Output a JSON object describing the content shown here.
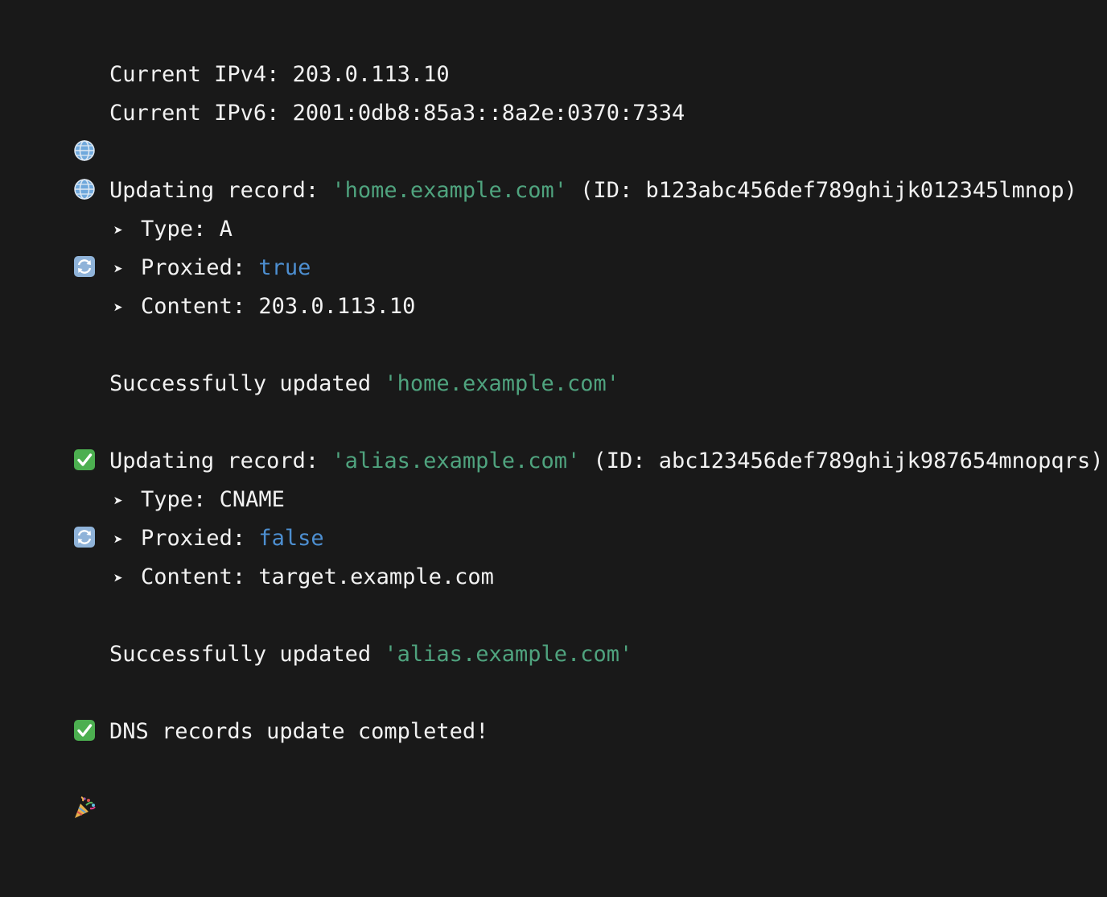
{
  "lines": {
    "ipv4": {
      "label": "Current IPv4: ",
      "value": "203.0.113.10"
    },
    "ipv6": {
      "label": "Current IPv6: ",
      "value": "2001:0db8:85a3::8a2e:0370:7334"
    },
    "update1": {
      "prefix": "Updating record: ",
      "name": "'home.example.com'",
      "id_text": " (ID: b123abc456def789ghijk012345lmnop)",
      "type_label": "Type: ",
      "type_value": "A",
      "proxied_label": "Proxied: ",
      "proxied_value": "true",
      "content_label": "Content: ",
      "content_value": "203.0.113.10"
    },
    "success1": {
      "prefix": "Successfully updated ",
      "name": "'home.example.com'"
    },
    "update2": {
      "prefix": "Updating record: ",
      "name": "'alias.example.com'",
      "id_text": " (ID: abc123456def789ghijk987654mnopqrs)",
      "type_label": "Type: ",
      "type_value": "CNAME",
      "proxied_label": "Proxied: ",
      "proxied_value": "false",
      "content_label": "Content: ",
      "content_value": "target.example.com"
    },
    "success2": {
      "prefix": "Successfully updated ",
      "name": "'alias.example.com'"
    },
    "done": {
      "text": "DNS records update completed!"
    }
  },
  "icons": {
    "globe": "globe-icon",
    "refresh": "refresh-icon",
    "check": "check-icon",
    "party": "party-popper-icon",
    "arrow": "arrow-icon"
  },
  "colors": {
    "background": "#191919",
    "text": "#f2f2f2",
    "string": "#4fa37e",
    "boolean": "#4d8fd1"
  }
}
